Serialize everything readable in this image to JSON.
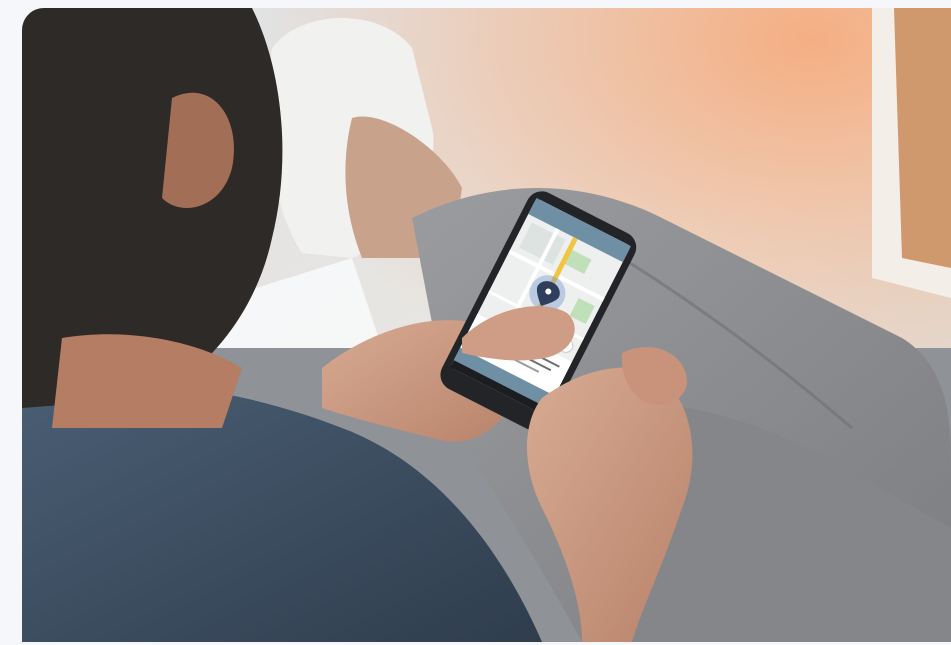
{
  "photo": {
    "subject": "person-holding-smartphone-with-map-app",
    "colors": {
      "page_bg": "#f5f7fb",
      "floor": "#e6e3dd",
      "door_wood": "#c98a57",
      "sofa": "#8f9296",
      "trousers": "#8e8f92",
      "shirt": "#3d4f63",
      "hair": "#2d2a28",
      "skin": "#c99a82",
      "phone_body": "#222427",
      "app_bar": "#6f8fa5",
      "map_bg": "#eef0ef",
      "route": "#f0c540",
      "pin": "#2f3e5b"
    },
    "phone_screen": {
      "app_title": "",
      "address_text": "",
      "button_text": ""
    }
  }
}
